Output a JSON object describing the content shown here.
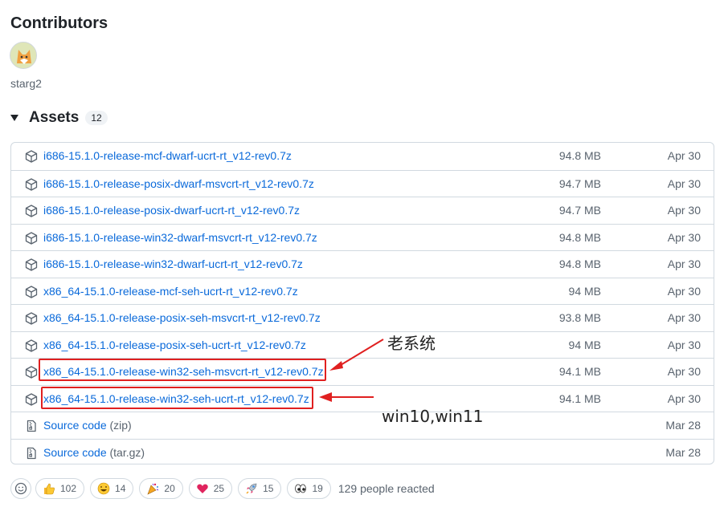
{
  "contributors": {
    "title": "Contributors",
    "users": [
      {
        "name": "starg2"
      }
    ]
  },
  "assets": {
    "title": "Assets",
    "count": "12",
    "items": [
      {
        "name": "i686-15.1.0-release-mcf-dwarf-ucrt-rt_v12-rev0.7z",
        "ext": "",
        "size": "94.8 MB",
        "date": "Apr 30",
        "icon": "package-icon"
      },
      {
        "name": "i686-15.1.0-release-posix-dwarf-msvcrt-rt_v12-rev0.7z",
        "ext": "",
        "size": "94.7 MB",
        "date": "Apr 30",
        "icon": "package-icon"
      },
      {
        "name": "i686-15.1.0-release-posix-dwarf-ucrt-rt_v12-rev0.7z",
        "ext": "",
        "size": "94.7 MB",
        "date": "Apr 30",
        "icon": "package-icon"
      },
      {
        "name": "i686-15.1.0-release-win32-dwarf-msvcrt-rt_v12-rev0.7z",
        "ext": "",
        "size": "94.8 MB",
        "date": "Apr 30",
        "icon": "package-icon"
      },
      {
        "name": "i686-15.1.0-release-win32-dwarf-ucrt-rt_v12-rev0.7z",
        "ext": "",
        "size": "94.8 MB",
        "date": "Apr 30",
        "icon": "package-icon"
      },
      {
        "name": "x86_64-15.1.0-release-mcf-seh-ucrt-rt_v12-rev0.7z",
        "ext": "",
        "size": "94 MB",
        "date": "Apr 30",
        "icon": "package-icon"
      },
      {
        "name": "x86_64-15.1.0-release-posix-seh-msvcrt-rt_v12-rev0.7z",
        "ext": "",
        "size": "93.8 MB",
        "date": "Apr 30",
        "icon": "package-icon"
      },
      {
        "name": "x86_64-15.1.0-release-posix-seh-ucrt-rt_v12-rev0.7z",
        "ext": "",
        "size": "94 MB",
        "date": "Apr 30",
        "icon": "package-icon"
      },
      {
        "name": "x86_64-15.1.0-release-win32-seh-msvcrt-rt_v12-rev0.7z",
        "ext": "",
        "size": "94.1 MB",
        "date": "Apr 30",
        "icon": "package-icon"
      },
      {
        "name": "x86_64-15.1.0-release-win32-seh-ucrt-rt_v12-rev0.7z",
        "ext": "",
        "size": "94.1 MB",
        "date": "Apr 30",
        "icon": "package-icon"
      },
      {
        "name": "Source code",
        "ext": "(zip)",
        "size": "",
        "date": "Mar 28",
        "icon": "file-zip-icon"
      },
      {
        "name": "Source code",
        "ext": "(tar.gz)",
        "size": "",
        "date": "Mar 28",
        "icon": "file-zip-icon"
      }
    ]
  },
  "annotations": {
    "old_system": "老系统",
    "new_system": "win10,win11",
    "color": "#e02020"
  },
  "reactions": {
    "items": [
      {
        "emoji": "thumbs-up-icon",
        "count": "102"
      },
      {
        "emoji": "laugh-icon",
        "count": "14"
      },
      {
        "emoji": "hooray-icon",
        "count": "20"
      },
      {
        "emoji": "heart-icon",
        "count": "25"
      },
      {
        "emoji": "rocket-icon",
        "count": "15"
      },
      {
        "emoji": "eyes-icon",
        "count": "19"
      }
    ],
    "summary": "129 people reacted"
  },
  "colors": {
    "link": "#0969da",
    "muted": "#59636e",
    "border": "#d1d9e0"
  }
}
